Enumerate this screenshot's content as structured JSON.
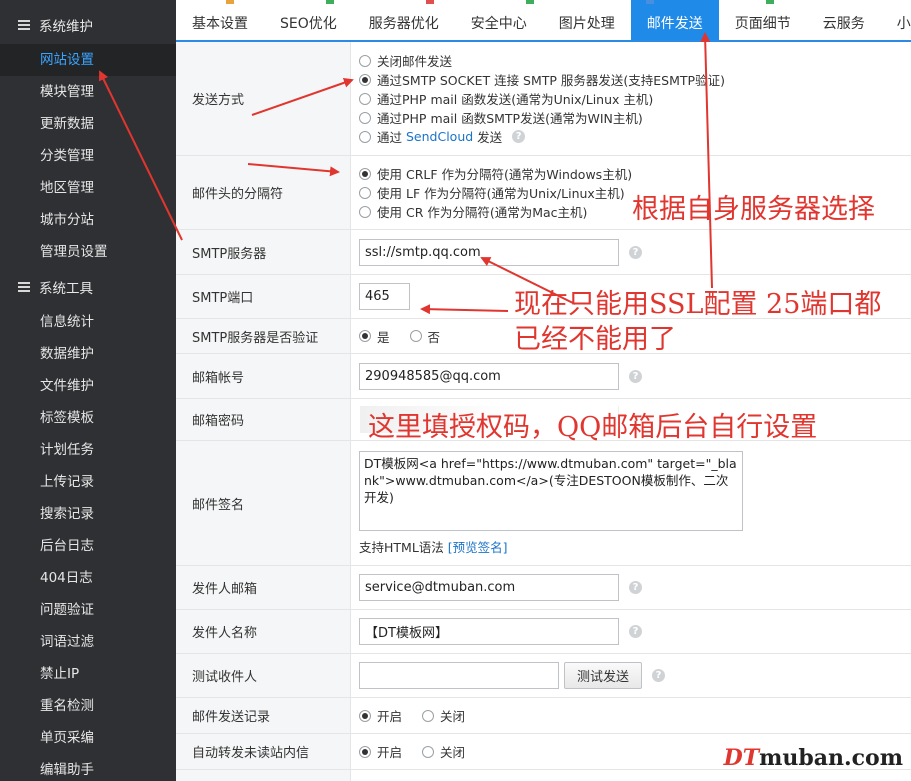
{
  "sidebar": {
    "section1": "系统维护",
    "items1": [
      "网站设置",
      "模块管理",
      "更新数据",
      "分类管理",
      "地区管理",
      "城市分站",
      "管理员设置"
    ],
    "section2": "系统工具",
    "items2": [
      "信息统计",
      "数据维护",
      "文件维护",
      "标签模板",
      "计划任务",
      "上传记录",
      "搜索记录",
      "后台日志",
      "404日志",
      "问题验证",
      "词语过滤",
      "禁止IP",
      "重名检测",
      "单页采编",
      "编辑助手"
    ]
  },
  "tabs": [
    "基本设置",
    "SEO优化",
    "服务器优化",
    "安全中心",
    "图片处理",
    "邮件发送",
    "页面细节",
    "云服务",
    "小"
  ],
  "form": {
    "send_mode": {
      "label": "发送方式",
      "options": [
        "关闭邮件发送",
        "通过SMTP SOCKET 连接 SMTP 服务器发送(支持ESMTP验证)",
        "通过PHP mail 函数发送(通常为Unix/Linux 主机)",
        "通过PHP mail 函数SMTP发送(通常为WIN主机)"
      ],
      "sendcloud_prefix": "通过 ",
      "sendcloud_link": "SendCloud",
      "sendcloud_suffix": " 发送"
    },
    "separator": {
      "label": "邮件头的分隔符",
      "options": [
        "使用 CRLF 作为分隔符(通常为Windows主机)",
        "使用 LF 作为分隔符(通常为Unix/Linux主机)",
        "使用 CR 作为分隔符(通常为Mac主机)"
      ]
    },
    "smtp_server": {
      "label": "SMTP服务器",
      "value": "ssl://smtp.qq.com"
    },
    "smtp_port": {
      "label": "SMTP端口",
      "value": "465"
    },
    "smtp_auth": {
      "label": "SMTP服务器是否验证",
      "yes": "是",
      "no": "否"
    },
    "mail_account": {
      "label": "邮箱帐号",
      "value": "290948585@qq.com"
    },
    "mail_password": {
      "label": "邮箱密码"
    },
    "signature": {
      "label": "邮件签名",
      "value": "DT模板网<a href=\"https://www.dtmuban.com\" target=\"_blank\">www.dtmuban.com</a>(专注DESTOON模板制作、二次开发)",
      "hint": "支持HTML语法",
      "preview": "[预览签名]"
    },
    "sender_email": {
      "label": "发件人邮箱",
      "value": "service@dtmuban.com"
    },
    "sender_name": {
      "label": "发件人名称",
      "value": "【DT模板网】"
    },
    "test_recipient": {
      "label": "测试收件人",
      "value": "",
      "button": "测试发送"
    },
    "send_log": {
      "label": "邮件发送记录",
      "on": "开启",
      "off": "关闭"
    },
    "auto_forward": {
      "label": "自动转发未读站内信",
      "on": "开启",
      "off": "关闭"
    }
  },
  "annotations": {
    "server_hint": "根据自身服务器选择",
    "ssl_line1": "现在只能用SSL配置 25端口都",
    "ssl_line2": "已经不能用了",
    "auth_code": "这里填授权码，QQ邮箱后台自行设置"
  },
  "watermark": {
    "prefix": "DT",
    "suffix": "muban.com"
  },
  "colors": {
    "annotation": "#e0362f",
    "active_tab": "#1f8ae8",
    "sidebar_bg": "#2f3033",
    "active_item": "#3aa4ff"
  }
}
